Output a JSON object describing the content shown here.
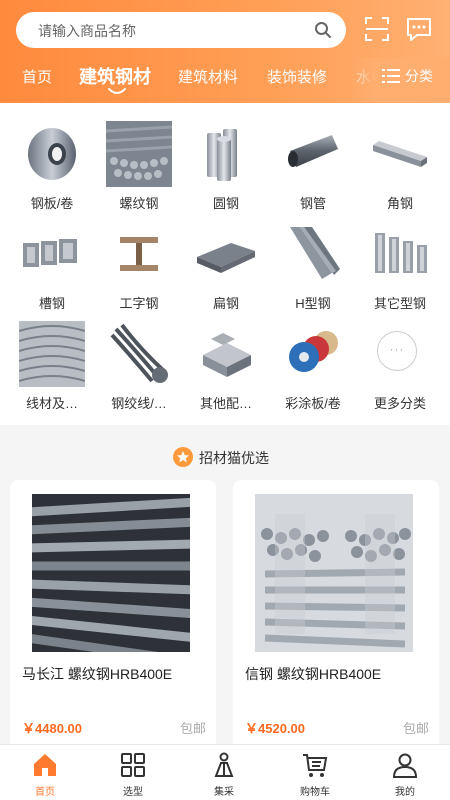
{
  "search": {
    "placeholder": "请输入商品名称"
  },
  "tabs": [
    {
      "label": "首页"
    },
    {
      "label": "建筑钢材"
    },
    {
      "label": "建筑材料"
    },
    {
      "label": "装饰装修"
    },
    {
      "label": "水电"
    }
  ],
  "category_button": {
    "label": "分类"
  },
  "categories": [
    {
      "label": "钢板/卷",
      "icon": "steel-coil"
    },
    {
      "label": "螺纹钢",
      "icon": "rebar-bundle"
    },
    {
      "label": "圆钢",
      "icon": "round-bar"
    },
    {
      "label": "钢管",
      "icon": "steel-pipe"
    },
    {
      "label": "角钢",
      "icon": "angle-steel"
    },
    {
      "label": "槽钢",
      "icon": "channel-steel"
    },
    {
      "label": "工字钢",
      "icon": "i-beam"
    },
    {
      "label": "扁钢",
      "icon": "flat-steel"
    },
    {
      "label": "H型钢",
      "icon": "h-beam"
    },
    {
      "label": "其它型钢",
      "icon": "other-profile"
    },
    {
      "label": "线材及…",
      "icon": "wire-rod"
    },
    {
      "label": "钢绞线/…",
      "icon": "strand"
    },
    {
      "label": "其他配…",
      "icon": "accessories"
    },
    {
      "label": "彩涂板/卷",
      "icon": "color-coil"
    },
    {
      "label": "更多分类",
      "icon": "more-dots"
    }
  ],
  "section": {
    "title": "招材猫优选"
  },
  "products": [
    {
      "name": "马长江 螺纹钢HRB400E",
      "price": "￥4480.00",
      "shipping": "包邮"
    },
    {
      "name": "信钢 螺纹钢HRB400E",
      "price": "￥4520.00",
      "shipping": "包邮"
    }
  ],
  "bottom_nav": [
    {
      "label": "首页",
      "icon": "home-icon"
    },
    {
      "label": "选型",
      "icon": "grid-icon"
    },
    {
      "label": "集采",
      "icon": "bulk-icon"
    },
    {
      "label": "购物车",
      "icon": "cart-icon"
    },
    {
      "label": "我的",
      "icon": "user-icon"
    }
  ],
  "colors": {
    "accent": "#ff8a3d",
    "price": "#ff6a1f"
  }
}
